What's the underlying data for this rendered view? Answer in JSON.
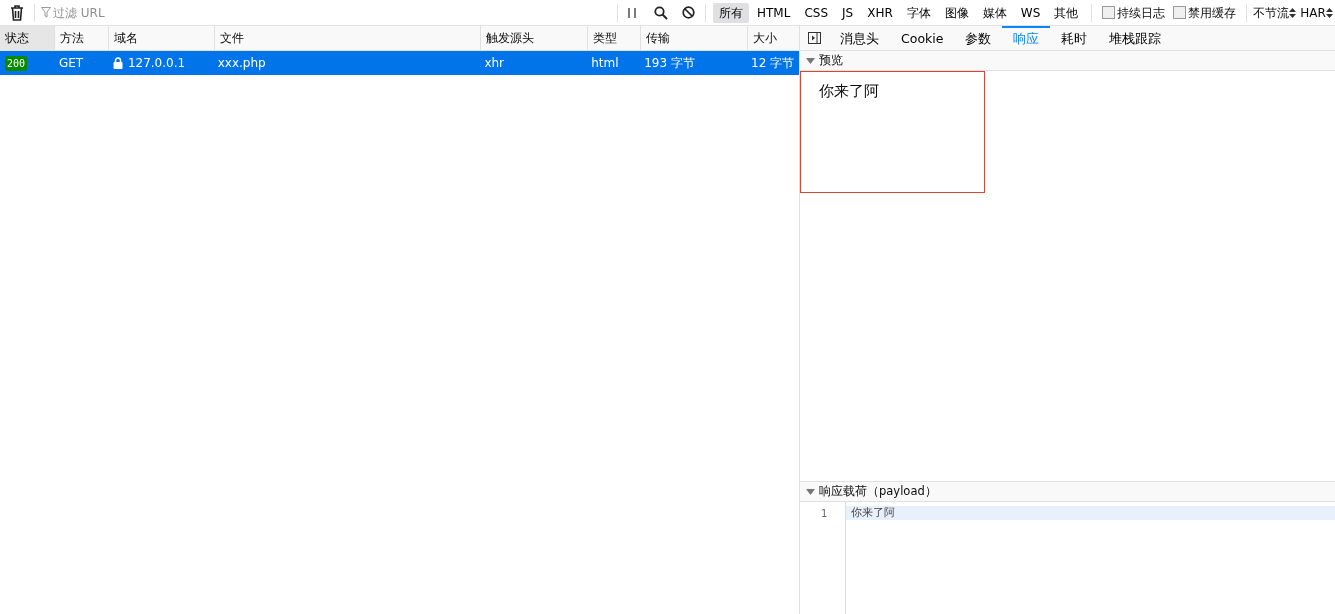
{
  "toolbar": {
    "filter": {
      "placeholder": "过滤 URL"
    },
    "type_filters": [
      {
        "label": "所有",
        "selected": true
      },
      {
        "label": "HTML",
        "selected": false
      },
      {
        "label": "CSS",
        "selected": false
      },
      {
        "label": "JS",
        "selected": false
      },
      {
        "label": "XHR",
        "selected": false
      },
      {
        "label": "字体",
        "selected": false
      },
      {
        "label": "图像",
        "selected": false
      },
      {
        "label": "媒体",
        "selected": false
      },
      {
        "label": "WS",
        "selected": false
      },
      {
        "label": "其他",
        "selected": false
      }
    ],
    "options": [
      {
        "label": "持续日志",
        "checked": false
      },
      {
        "label": "禁用缓存",
        "checked": false
      }
    ],
    "throttle": "不节流",
    "har": "HAR"
  },
  "table": {
    "columns": [
      {
        "label": "状态",
        "sorted": true
      },
      {
        "label": "方法",
        "sorted": false
      },
      {
        "label": "域名",
        "sorted": false
      },
      {
        "label": "文件",
        "sorted": false
      },
      {
        "label": "触发源头",
        "sorted": false
      },
      {
        "label": "类型",
        "sorted": false
      },
      {
        "label": "传输",
        "sorted": false
      },
      {
        "label": "大小",
        "sorted": false
      }
    ],
    "rows": [
      {
        "status": "200",
        "method": "GET",
        "secure": true,
        "domain": "127.0.0.1",
        "file": "xxx.php",
        "cause": "xhr",
        "type": "html",
        "transferred": "193 字节",
        "size": "12 字节",
        "selected": true
      }
    ]
  },
  "details": {
    "tabs": [
      {
        "label": "消息头",
        "selected": false
      },
      {
        "label": "Cookie",
        "selected": false
      },
      {
        "label": "参数",
        "selected": false
      },
      {
        "label": "响应",
        "selected": true
      },
      {
        "label": "耗时",
        "selected": false
      },
      {
        "label": "堆栈跟踪",
        "selected": false
      }
    ],
    "preview": {
      "title": "预览",
      "expanded": true,
      "text": "你来了阿"
    },
    "payload": {
      "title": "响应载荷（payload）",
      "expanded": true,
      "lines": [
        {
          "number": "1",
          "text": "你来了阿"
        }
      ]
    }
  }
}
